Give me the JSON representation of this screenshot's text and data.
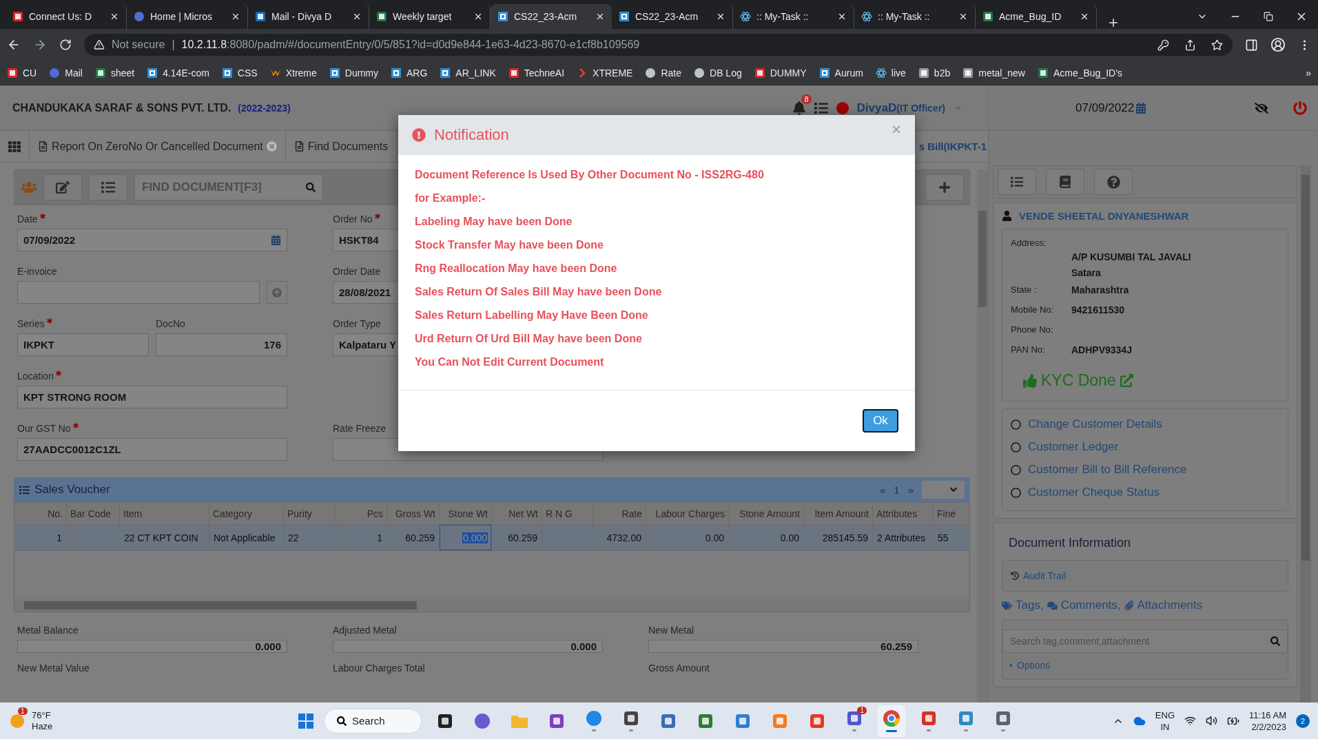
{
  "browser": {
    "tabs": [
      {
        "title": "Connect Us: D",
        "kind": "site",
        "selected": false
      },
      {
        "title": "Home | Micros",
        "kind": "edge",
        "selected": false
      },
      {
        "title": "Mail - Divya D",
        "kind": "outlook",
        "selected": false
      },
      {
        "title": "Weekly target",
        "kind": "excel",
        "selected": false
      },
      {
        "title": "CS22_23-Acm",
        "kind": "grid",
        "selected": true
      },
      {
        "title": "CS22_23-Acm",
        "kind": "grid",
        "selected": false
      },
      {
        "title": ":: My-Task ::",
        "kind": "react",
        "selected": false
      },
      {
        "title": ":: My-Task ::",
        "kind": "react",
        "selected": false
      },
      {
        "title": "Acme_Bug_ID",
        "kind": "excel",
        "selected": false
      }
    ],
    "address": {
      "security": "Not secure",
      "separator": "|",
      "host": "10.2.11.8",
      "path": ":8080/padm/#/documentEntry/0/5/851?id=d0d9e844-1e63-4d23-8670-e1cf8b109569"
    },
    "bookmarks": [
      {
        "label": "CU",
        "kind": "site"
      },
      {
        "label": "Mail",
        "kind": "edge"
      },
      {
        "label": "sheet",
        "kind": "excel"
      },
      {
        "label": "4.14E-com",
        "kind": "grid"
      },
      {
        "label": "CSS",
        "kind": "grid"
      },
      {
        "label": "Xtreme",
        "kind": "xtreme"
      },
      {
        "label": "Dummy",
        "kind": "grid"
      },
      {
        "label": "ARG",
        "kind": "grid"
      },
      {
        "label": "AR_LINK",
        "kind": "grid"
      },
      {
        "label": "TechneAI",
        "kind": "site"
      },
      {
        "label": "XTREME",
        "kind": "chevron"
      },
      {
        "label": "Rate",
        "kind": "globe"
      },
      {
        "label": "DB Log",
        "kind": "globe"
      },
      {
        "label": "DUMMY",
        "kind": "site"
      },
      {
        "label": "Aurum",
        "kind": "grid"
      },
      {
        "label": "live",
        "kind": "react"
      },
      {
        "label": "b2b",
        "kind": "server"
      },
      {
        "label": "metal_new",
        "kind": "server"
      },
      {
        "label": "Acme_Bug_ID's",
        "kind": "excel"
      }
    ],
    "more": "»"
  },
  "app": {
    "company": "CHANDUKAKA SARAF & SONS PVT. LTD.",
    "year": "(2022-2023)",
    "notifications": "8",
    "user": "DivyaD",
    "role": "(IT Officer)",
    "date": "07/09/2022"
  },
  "doc_tabs": [
    {
      "label": "Report On ZeroNo Or Cancelled Document",
      "closable": true
    },
    {
      "label": "Find Documents",
      "closable": false
    },
    {
      "label": "s Bill(IKPKT-1",
      "closable": false
    }
  ],
  "toolbar": {
    "search_placeholder": "FIND DOCUMENT[F3]"
  },
  "form": {
    "rows": [
      {
        "left": [
          {
            "label": "Date",
            "required": true,
            "value": "07/09/2022",
            "kind": "date"
          }
        ],
        "middle": {
          "label": "Order No",
          "required": true,
          "value": "HSKT84"
        }
      },
      {
        "left": [
          {
            "label": "E-invoice",
            "required": false,
            "kind": "upload"
          }
        ],
        "middle": {
          "label": "Order Date",
          "required": false,
          "value": "28/08/2021"
        }
      },
      {
        "left": [
          {
            "label": "Series",
            "required": true,
            "value": "IKPKT"
          },
          {
            "label": "DocNo",
            "required": false,
            "value": "176",
            "kind": "number"
          }
        ],
        "middle": {
          "label": "Order Type",
          "required": false,
          "value": "Kalpataru Y"
        }
      },
      {
        "left": [
          {
            "label": "Location",
            "required": true,
            "value": "KPT STRONG ROOM"
          }
        ]
      },
      {
        "left": [
          {
            "label": "Our GST No",
            "required": true,
            "value": "27AADCC0012C1ZL"
          }
        ],
        "middle": {
          "label": "Rate Freeze",
          "required": false
        }
      }
    ]
  },
  "voucher": {
    "title": "Sales Voucher",
    "prev": "«",
    "page": "1",
    "next": "»",
    "columns": [
      {
        "label": "No.",
        "numeric": true
      },
      {
        "label": "Bar Code",
        "numeric": false
      },
      {
        "label": "Item",
        "numeric": false
      },
      {
        "label": "Category",
        "numeric": false
      },
      {
        "label": "Purity",
        "numeric": false
      },
      {
        "label": "Pcs",
        "numeric": true
      },
      {
        "label": "Gross Wt",
        "numeric": true
      },
      {
        "label": "Stone Wt",
        "numeric": true
      },
      {
        "label": "Net Wt",
        "numeric": true
      },
      {
        "label": "R N G",
        "numeric": false
      },
      {
        "label": "Rate",
        "numeric": true
      },
      {
        "label": "Labour Charges",
        "numeric": true
      },
      {
        "label": "Stone Amount",
        "numeric": true
      },
      {
        "label": "Item Amount",
        "numeric": true
      },
      {
        "label": "Attributes",
        "numeric": false
      },
      {
        "label": "Fine",
        "numeric": false
      }
    ],
    "rows": [
      {
        "selected": true,
        "cells": [
          {
            "text": "1",
            "selected": false
          },
          {
            "selected": false
          },
          {
            "text": "22 CT KPT COIN",
            "selected": false
          },
          {
            "text": "Not Applicable",
            "selected": false
          },
          {
            "text": "22",
            "selected": false
          },
          {
            "text": "1",
            "selected": false
          },
          {
            "text": "60.259",
            "selected": false
          },
          {
            "text": "0.000",
            "selected": true
          },
          {
            "text": "60.259",
            "selected": false
          },
          {
            "selected": false
          },
          {
            "text": "4732.00",
            "selected": false
          },
          {
            "text": "0.00",
            "selected": false
          },
          {
            "text": "0.00",
            "selected": false
          },
          {
            "text": "285145.59",
            "selected": false
          },
          {
            "text": "2 Attributes",
            "selected": false
          },
          {
            "text": "55",
            "selected": false
          }
        ]
      }
    ]
  },
  "totals": [
    {
      "label": "Metal Balance",
      "value": "0.000"
    },
    {
      "label": "Adjusted Metal",
      "value": "0.000"
    },
    {
      "label": "New Metal",
      "value": "60.259"
    }
  ],
  "totals_next": [
    "New Metal Value",
    "Labour Charges Total",
    "Gross Amount"
  ],
  "customer": {
    "name": "VENDE SHEETAL DNYANESHWAR",
    "details": [
      {
        "label": "Address:",
        "kind": "block",
        "values": [
          "A/P KUSUMBI TAL JAVALI",
          "Satara"
        ]
      },
      {
        "label": "State :",
        "kind": "inline",
        "values": [
          "Maharashtra"
        ]
      },
      {
        "label": "Mobile No:",
        "kind": "inline",
        "values": [
          "9421611530"
        ]
      },
      {
        "label": "Phone No:",
        "kind": "inline"
      },
      {
        "label": "PAN No:",
        "kind": "inline",
        "values": [
          "ADHPV9334J"
        ]
      }
    ],
    "kyc": "KYC Done"
  },
  "links": [
    "Change Customer Details",
    "Customer Ledger",
    "Customer Bill to Bill Reference",
    "Customer Cheque Status"
  ],
  "doc_info": {
    "title": "Document Information",
    "audit": "Audit Trail",
    "tags": "Tags,",
    "comments": "Comments,",
    "attachments": "Attachments",
    "search_placeholder": "Search tag,comment,attachment",
    "options": "Options"
  },
  "dialog": {
    "title": "Notification",
    "close": "×",
    "lines": [
      "Document Reference Is Used By Other Document No - ISS2RG-480",
      "for Example:-",
      "Labeling May have been Done",
      "Stock Transfer May have been Done",
      "Rng Reallocation May have been Done",
      "Sales Return Of Sales Bill May have been Done",
      "Sales Return Labelling May Have Been Done",
      "Urd Return Of Urd Bill May have been Done",
      "You Can Not Edit Current Document"
    ],
    "button": "Ok"
  },
  "taskbar": {
    "weather": {
      "temp": "76°F",
      "condition": "Haze",
      "badge": "1"
    },
    "search": "Search",
    "apps": [
      {
        "kind": "taskview",
        "running": false,
        "selected": false
      },
      {
        "kind": "chat",
        "running": false,
        "selected": false
      },
      {
        "kind": "folder",
        "running": false,
        "selected": false
      },
      {
        "kind": "vs",
        "running": false,
        "selected": false
      },
      {
        "kind": "phone",
        "running": true,
        "selected": false
      },
      {
        "kind": "vnc",
        "running": true,
        "selected": false
      },
      {
        "kind": "network",
        "running": false,
        "selected": false
      },
      {
        "kind": "remote",
        "running": false,
        "selected": false
      },
      {
        "kind": "dolphin",
        "running": false,
        "selected": false
      },
      {
        "kind": "xampp",
        "running": false,
        "selected": false
      },
      {
        "kind": "anydesk",
        "running": false,
        "selected": false
      },
      {
        "kind": "teams",
        "running": true,
        "selected": false,
        "badge": "1"
      },
      {
        "kind": "chrome",
        "running": true,
        "selected": true
      },
      {
        "kind": "wps",
        "running": true,
        "selected": false
      },
      {
        "kind": "notepad",
        "running": true,
        "selected": false
      },
      {
        "kind": "calculator",
        "running": true,
        "selected": false
      }
    ],
    "lang": "ENG",
    "region": "IN",
    "time": "11:16 AM",
    "date": "2/2/2023",
    "notifications": "2"
  }
}
